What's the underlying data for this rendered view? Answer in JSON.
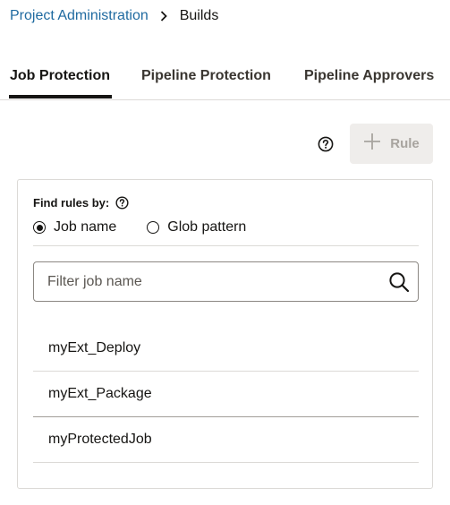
{
  "breadcrumb": {
    "parent": "Project Administration",
    "current": "Builds"
  },
  "tabs": [
    {
      "label": "Job Protection",
      "active": true
    },
    {
      "label": "Pipeline Protection",
      "active": false
    },
    {
      "label": "Pipeline Approvers",
      "active": false
    }
  ],
  "toolbar": {
    "rule_label": "Rule",
    "rule_disabled": true
  },
  "filter": {
    "find_label": "Find rules by:",
    "radio_job": "Job name",
    "radio_glob": "Glob pattern",
    "selected": "Job name",
    "placeholder": "Filter job name",
    "value": ""
  },
  "jobs": [
    {
      "name": "myExt_Deploy"
    },
    {
      "name": "myExt_Package"
    },
    {
      "name": "myProtectedJob"
    }
  ],
  "colors": {
    "link": "#1f6aa0",
    "text": "#161513",
    "disabled_bg": "#efedeb"
  },
  "icons": [
    "chevron-right-icon",
    "help-icon",
    "plus-icon",
    "search-icon"
  ]
}
